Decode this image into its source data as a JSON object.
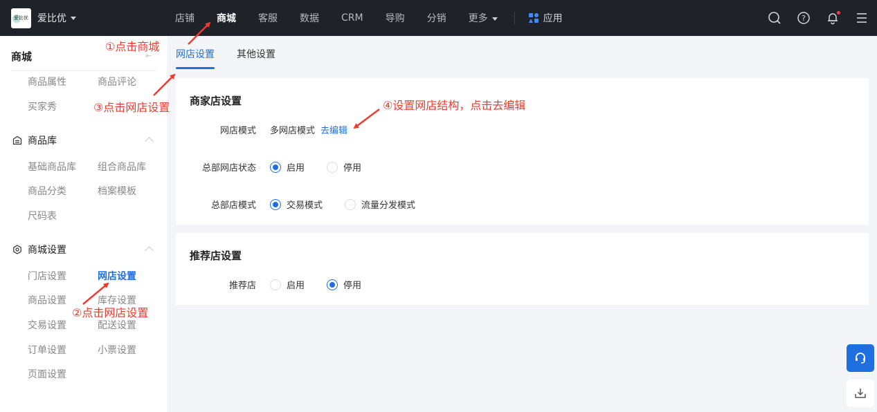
{
  "topbar": {
    "brand": {
      "logo_text": "爱比优",
      "name": "爱比优"
    },
    "nav": [
      {
        "label": "店铺",
        "active": false
      },
      {
        "label": "商城",
        "active": true
      },
      {
        "label": "客服",
        "active": false
      },
      {
        "label": "数据",
        "active": false
      },
      {
        "label": "CRM",
        "active": false
      },
      {
        "label": "导购",
        "active": false
      },
      {
        "label": "分销",
        "active": false
      },
      {
        "label": "更多",
        "active": false,
        "dropdown": true
      }
    ],
    "apps_label": "应用",
    "icons": [
      "search-icon",
      "help-icon",
      "bell-icon",
      "menu-icon"
    ],
    "notification_dot": true
  },
  "sidebar": {
    "title": "商城",
    "top_items": [
      "商品属性",
      "商品评论",
      "买家秀"
    ],
    "groups": [
      {
        "label": "商品库",
        "icon": "warehouse-icon",
        "expanded": true,
        "items": [
          "基础商品库",
          "组合商品库",
          "商品分类",
          "档案模板",
          "尺码表"
        ]
      },
      {
        "label": "商城设置",
        "icon": "settings-hex-icon",
        "expanded": true,
        "items": [
          "门店设置",
          "网店设置",
          "商品设置",
          "库存设置",
          "交易设置",
          "配送设置",
          "订单设置",
          "小票设置",
          "页面设置"
        ],
        "active_item": "网店设置"
      }
    ]
  },
  "tabs": [
    {
      "label": "网店设置",
      "active": true
    },
    {
      "label": "其他设置",
      "active": false
    }
  ],
  "merchant_card": {
    "title": "商家店设置",
    "shop_mode": {
      "label": "网店模式",
      "value": "多网店模式",
      "link": "去编辑"
    },
    "hq_status": {
      "label": "总部网店状态",
      "options": [
        "启用",
        "停用"
      ],
      "selected": "启用"
    },
    "hq_mode": {
      "label": "总部店模式",
      "options": [
        "交易模式",
        "流量分发模式"
      ],
      "selected": "交易模式"
    }
  },
  "recommend_card": {
    "title": "推荐店设置",
    "recommend": {
      "label": "推荐店",
      "options": [
        "启用",
        "停用"
      ],
      "selected": "停用"
    }
  },
  "annotations": {
    "a1": "①点击商城",
    "a2": "②点击网店设置",
    "a3": "③点击网店设置",
    "a4": "④设置网店结构，点击去编辑",
    "color": "#f03a2e"
  },
  "colors": {
    "accent": "#1f6fe0",
    "topbar": "#1f2228",
    "background": "#f4f5f8"
  }
}
